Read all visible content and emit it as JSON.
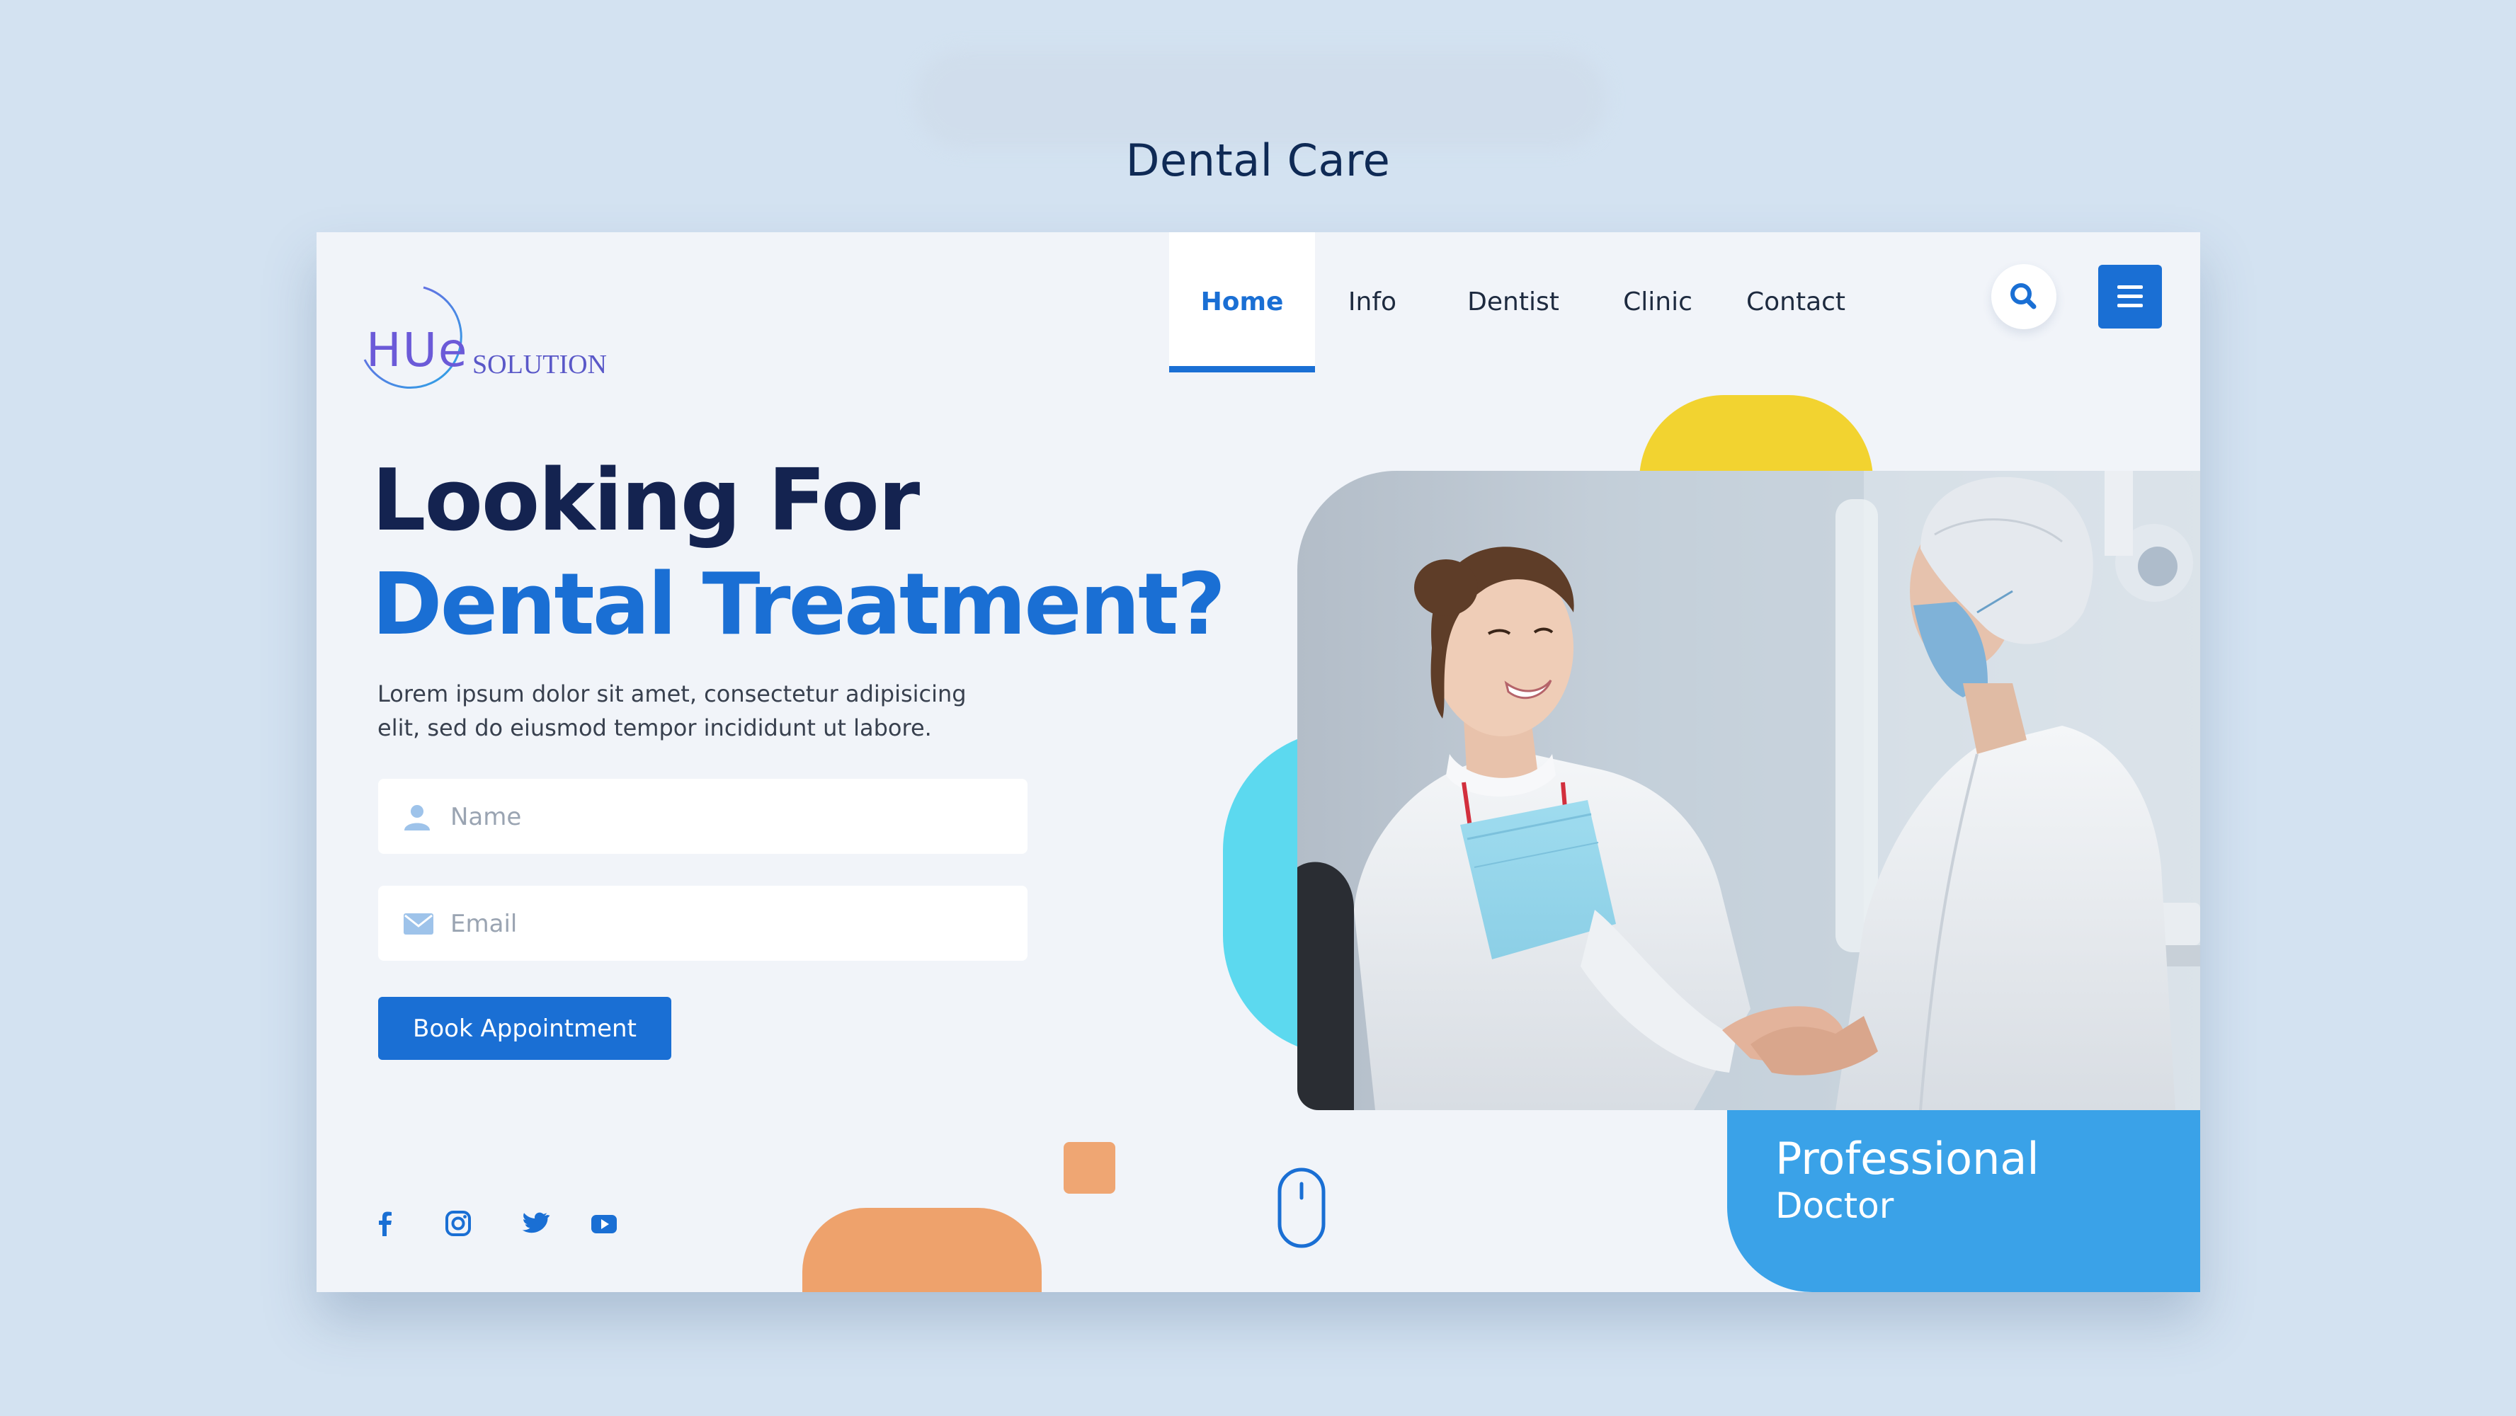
{
  "page": {
    "heading": "Dental Care"
  },
  "logo": {
    "mark": "HUe",
    "text": "SOLUTION"
  },
  "nav": {
    "items": [
      {
        "label": "Home",
        "active": true
      },
      {
        "label": "Info",
        "active": false
      },
      {
        "label": "Dentist",
        "active": false
      },
      {
        "label": "Clinic",
        "active": false
      },
      {
        "label": "Contact",
        "active": false
      }
    ],
    "search_icon": "search-icon",
    "menu_icon": "hamburger-menu-icon"
  },
  "hero": {
    "title_line1": "Looking For",
    "title_line2": "Dental Treatment?",
    "description": "Lorem ipsum dolor sit amet, consectetur adipisicing elit, sed do eiusmod tempor incididunt ut labore.",
    "name_field": {
      "placeholder": "Name",
      "value": "",
      "icon": "user-icon"
    },
    "email_field": {
      "placeholder": "Email",
      "value": "",
      "icon": "envelope-icon"
    },
    "button_label": "Book Appointment"
  },
  "social": [
    "facebook-icon",
    "instagram-icon",
    "twitter-icon",
    "youtube-icon"
  ],
  "badge": {
    "line1": "Professional",
    "line2": "Doctor"
  },
  "colors": {
    "primary": "#1a6fd4",
    "navy": "#142350",
    "badge": "#3aa2e8",
    "yellow": "#f2d330",
    "cyan": "#5cd9ef",
    "orange": "#eea26c",
    "background": "#d3e2f1"
  }
}
